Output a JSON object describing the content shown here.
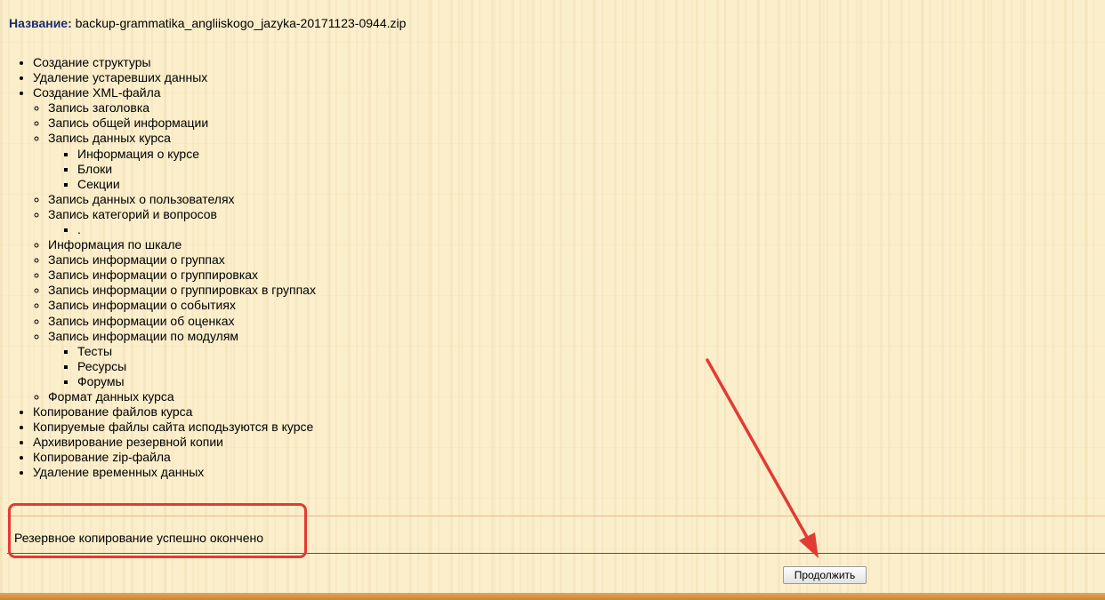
{
  "backup": {
    "name_label": "Название:",
    "file_name": "backup-grammatika_angliiskogo_jazyka-20171123-0944.zip"
  },
  "steps": [
    "Создание структуры",
    "Удаление устаревших данных",
    "Создание XML-файла",
    "Копирование файлов курса",
    "Копируемые файлы сайта исподьзуются в курсе",
    "Архивирование резервной копии",
    "Копирование zip-файла",
    "Удаление временных данных"
  ],
  "xml_steps": [
    "Запись заголовка",
    "Запись общей информации",
    "Запись данных курса",
    "Запись данных о пользователях",
    "Запись категорий и вопросов",
    "Информация по шкале",
    "Запись информации о группах",
    "Запись информации о группировках",
    "Запись информации о группировках в группах",
    "Запись информации о событиях",
    "Запись информации об оценках",
    "Запись информации по модулям",
    "Формат данных курса"
  ],
  "course_data_steps": [
    "Информация о курсе",
    "Блоки",
    "Секции"
  ],
  "categories_dot": ".",
  "module_steps": [
    "Тесты",
    "Ресурсы",
    "Форумы"
  ],
  "status_message": "Резервное копирование успешно окончено",
  "continue_label": "Продолжить",
  "colors": {
    "annotation_red": "#e23b34",
    "name_label": "#1a2c70",
    "background": "#fbeeca"
  }
}
